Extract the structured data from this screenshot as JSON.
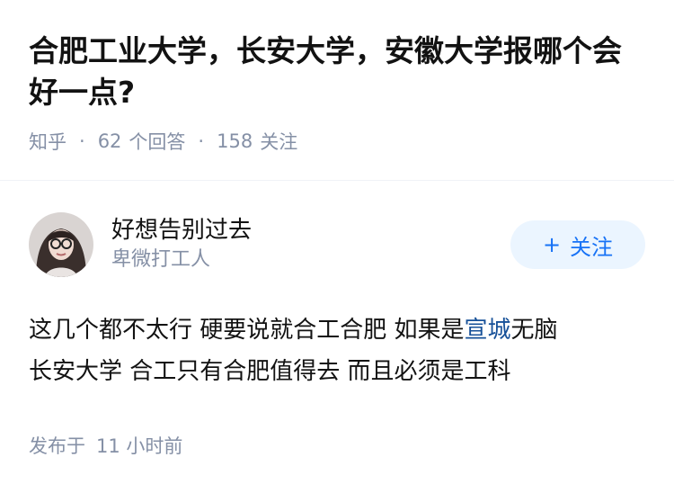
{
  "question": {
    "title": "合肥工业大学，长安大学，安徽大学报哪个会好一点?",
    "source": "知乎",
    "answers_count": "62",
    "answers_label": "个回答",
    "followers_count": "158",
    "followers_label": "关注"
  },
  "answer": {
    "author_name": "好想告别过去",
    "author_headline": "卑微打工人",
    "follow_label": "关注",
    "follow_icon": "plus-icon",
    "content_line1_before_link": "这几个都不太行 硬要说就合工合肥 如果是",
    "content_link": "宣城",
    "content_line1_after_link": "无脑",
    "content_line2": "长安大学 合工只有合肥值得去 而且必须是工科",
    "published_prefix": "发布于",
    "published_time": "11 小时前"
  },
  "colors": {
    "title": "#121212",
    "meta": "#8590a6",
    "accent": "#1772f6",
    "follow_bg": "#ebf5ff",
    "link": "#175199"
  }
}
